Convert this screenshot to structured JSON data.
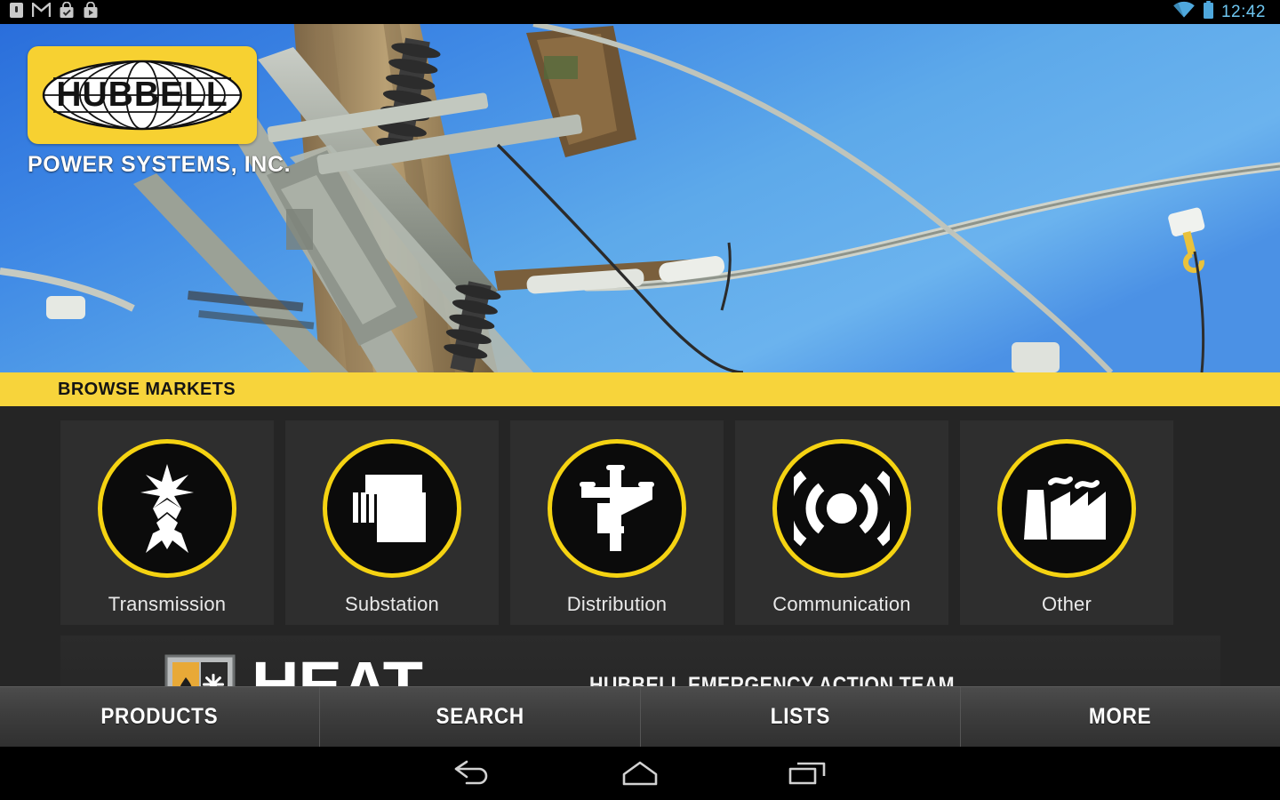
{
  "status_bar": {
    "left_icons": [
      {
        "name": "sim-card-icon",
        "label": "SIM"
      },
      {
        "name": "gmail-icon",
        "label": "Gmail"
      },
      {
        "name": "tasks-bag-icon",
        "label": "Tasks"
      },
      {
        "name": "play-store-bag-icon",
        "label": "Play Store"
      }
    ],
    "wifi_icon": "wifi-icon",
    "battery_icon": "battery-icon",
    "clock": "12:42",
    "icon_color": "#6ec6f0"
  },
  "hero": {
    "alt": "utility pole with switchgear against blue sky",
    "logo": {
      "brand": "HUBBELL",
      "subtitle": "POWER SYSTEMS, INC.",
      "plate_color": "#f7d131"
    }
  },
  "section_bar": {
    "title": "BROWSE MARKETS",
    "background": "#f7d43b",
    "text_color": "#141414"
  },
  "markets": {
    "accent": "#f5d312",
    "card_background": "#2e2e2e",
    "items": [
      {
        "label": "Transmission",
        "icon": "transmission-tower-icon"
      },
      {
        "label": "Substation",
        "icon": "substation-transformer-icon"
      },
      {
        "label": "Distribution",
        "icon": "distribution-pole-icon"
      },
      {
        "label": "Communication",
        "icon": "broadcast-signal-icon"
      },
      {
        "label": "Other",
        "icon": "factory-icon"
      }
    ]
  },
  "heat_promo": {
    "logo_text": "HEAT",
    "tagline": "HUBBELL EMERGENCY ACTION TEAM",
    "shield_icon": "heat-shield-icon"
  },
  "tabbar": {
    "tabs": [
      {
        "label": "PRODUCTS"
      },
      {
        "label": "SEARCH"
      },
      {
        "label": "LISTS"
      },
      {
        "label": "MORE"
      }
    ]
  },
  "navbar": {
    "buttons": [
      {
        "name": "back-icon",
        "label": "Back"
      },
      {
        "name": "home-icon",
        "label": "Home"
      },
      {
        "name": "recents-icon",
        "label": "Recent apps"
      }
    ]
  }
}
